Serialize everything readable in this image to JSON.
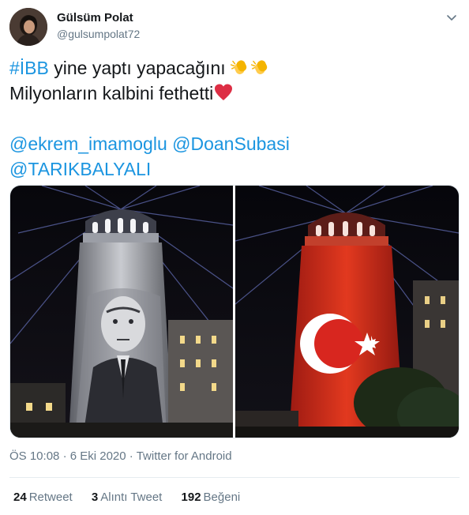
{
  "author": {
    "name": "Gülsüm Polat",
    "handle": "@gulsumpolat72"
  },
  "tweet": {
    "hashtag": "#İBB",
    "line1_text": " yine yaptı yapacağını ",
    "line1_emojis": [
      "clapping-hands",
      "clapping-hands"
    ],
    "line2_text": "Milyonların kalbini  fethetti",
    "line2_emoji": "red-heart",
    "mentions_line1": [
      "@ekrem_imamoglu",
      "@DoanSubasi"
    ],
    "mentions_line2": [
      "@TARIKBALYALI"
    ]
  },
  "media": {
    "photos": [
      {
        "alt_subject": "galata-tower-projection-portrait"
      },
      {
        "alt_subject": "galata-tower-projection-turkish-flag"
      }
    ]
  },
  "meta": {
    "time": "ÖS 10:08",
    "separator": "·",
    "date": "6 Eki 2020",
    "source": "Twitter for Android"
  },
  "stats": {
    "retweets_count": "24",
    "retweets_label": "Retweet",
    "quotes_count": "3",
    "quotes_label": "Alıntı Tweet",
    "likes_count": "192",
    "likes_label": "Beğeni"
  },
  "colors": {
    "link": "#1b95e0",
    "text": "#14171a",
    "secondary": "#657786",
    "divider": "#e6ecf0",
    "flag_red": "#d8261f"
  }
}
